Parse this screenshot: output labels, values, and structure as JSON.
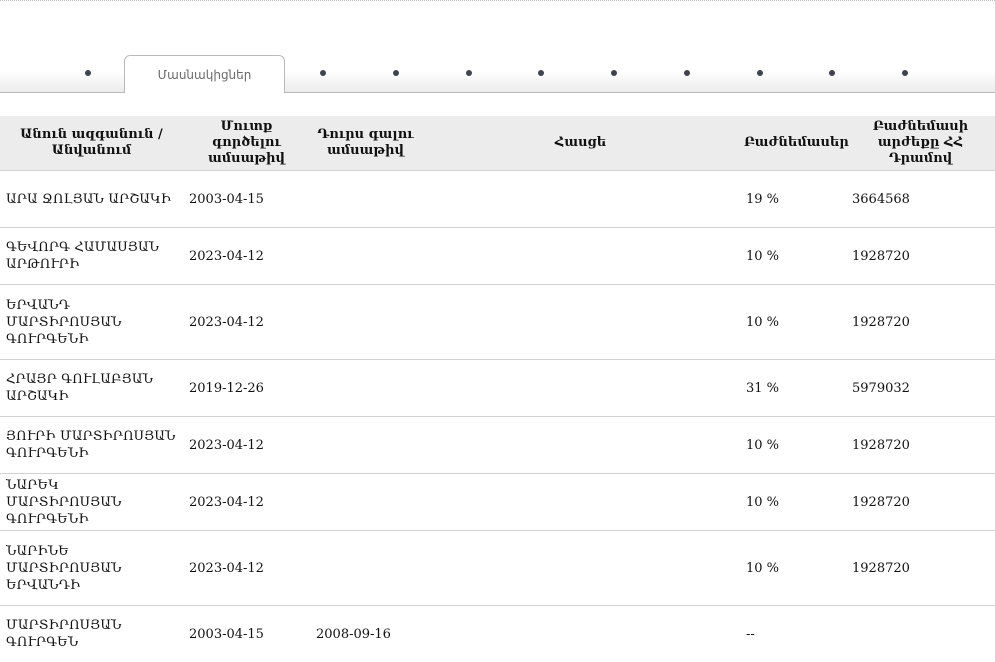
{
  "tabs": {
    "active_label": "Մասնակիցներ",
    "dot_count": 9
  },
  "table": {
    "headers": {
      "name": "Անուն ազգանուն / Անվանում",
      "entry_date": "Մուտք գործելու ամսաթիվ",
      "exit_date": "Դուրս գալու ամսաթիվ",
      "address": "Հասցե",
      "shares": "Բաժնեմասեր",
      "share_value": "Բաժնեմասի արժեքը ՀՀ Դրամով"
    },
    "rows": [
      {
        "name": "ԱՐԱ ՋՈԼՅԱՆ ԱՐՇԱԿԻ",
        "entry_date": "2003-04-15",
        "exit_date": "",
        "address": "",
        "shares": "19 %",
        "share_value": "3664568"
      },
      {
        "name": "ԳԵՎՈՐԳ ՀԱՄԱՍՅԱՆ ԱՐԹՈՒՐԻ",
        "entry_date": "2023-04-12",
        "exit_date": "",
        "address": "",
        "shares": "10 %",
        "share_value": "1928720"
      },
      {
        "name": "ԵՐՎԱՆԴ ՄԱՐՏԻՐՈՍՅԱՆ ԳՈՒՐԳԵՆԻ",
        "entry_date": "2023-04-12",
        "exit_date": "",
        "address": "",
        "shares": "10 %",
        "share_value": "1928720"
      },
      {
        "name": "ՀՐԱՅՐ ԳՈՒԼԱԲՅԱՆ ԱՐՇԱԿԻ",
        "entry_date": "2019-12-26",
        "exit_date": "",
        "address": "",
        "shares": "31 %",
        "share_value": "5979032"
      },
      {
        "name": "ՅՈՒՐԻ ՄԱՐՏԻՐՈՍՅԱՆ ԳՈՒՐԳԵՆԻ",
        "entry_date": "2023-04-12",
        "exit_date": "",
        "address": "",
        "shares": "10 %",
        "share_value": "1928720"
      },
      {
        "name": "ՆԱՐԵԿ ՄԱՐՏԻՐՈՍՅԱՆ ԳՈՒՐԳԵՆԻ",
        "entry_date": "2023-04-12",
        "exit_date": "",
        "address": "",
        "shares": "10 %",
        "share_value": "1928720"
      },
      {
        "name": "ՆԱՐԻՆԵ ՄԱՐՏԻՐՈՍՅԱՆ ԵՐՎԱՆԴԻ",
        "entry_date": "2023-04-12",
        "exit_date": "",
        "address": "",
        "shares": "10 %",
        "share_value": "1928720"
      },
      {
        "name": "ՄԱՐՏԻՐՈՍՅԱՆ ԳՈՒՐԳԵՆ",
        "entry_date": "2003-04-15",
        "exit_date": "2008-09-16",
        "address": "",
        "shares": "--",
        "share_value": ""
      }
    ]
  }
}
